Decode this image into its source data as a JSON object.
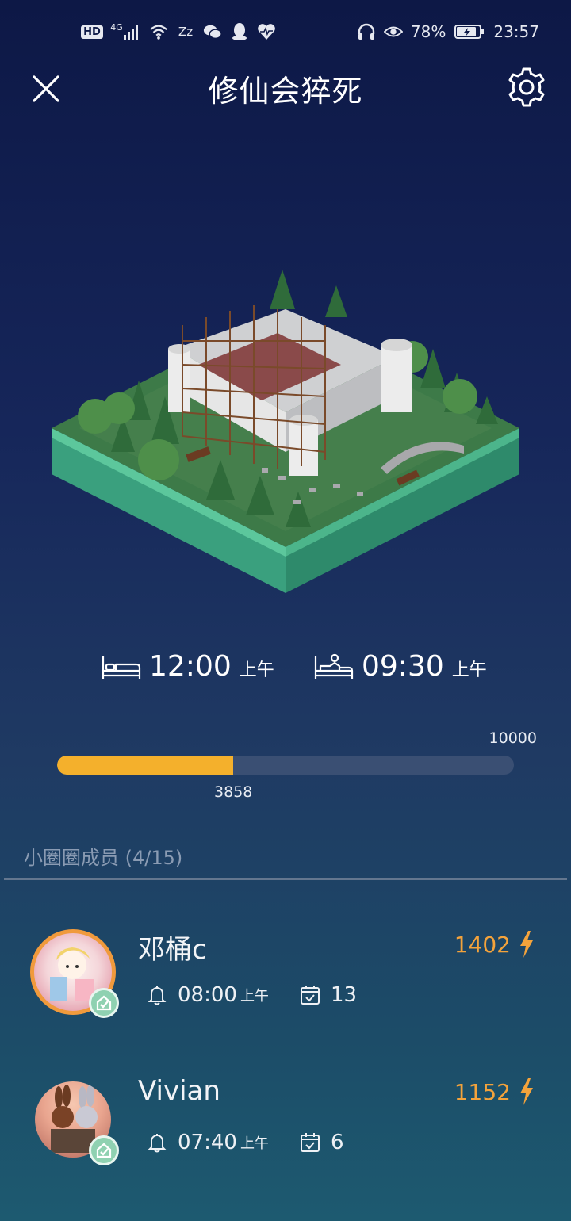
{
  "status_bar": {
    "left_icons": [
      "hd-icon",
      "signal-4g-icon",
      "wifi-icon",
      "sleep-zz-icon",
      "wechat-icon",
      "qq-icon",
      "heart-rate-icon"
    ],
    "hd_label": "HD",
    "net_label": "4G",
    "zz_label": "Zz",
    "battery_percent": "78%",
    "time": "23:57"
  },
  "header": {
    "title": "修仙会猝死",
    "close_icon": "close-icon",
    "settings_icon": "gear-icon"
  },
  "sleep_times": {
    "bedtime": {
      "icon": "bed-icon",
      "value": "12:00",
      "suffix": "上午"
    },
    "wakeup": {
      "icon": "wake-up-bed-icon",
      "value": "09:30",
      "suffix": "上午"
    }
  },
  "progress": {
    "current": "3858",
    "max": "10000",
    "fraction": 0.3858,
    "fill_color": "#f4b02c",
    "track_color": "#3a4f73"
  },
  "members_section": {
    "label": "小圈圈成员 (4/15)"
  },
  "members": [
    {
      "name": "邓桶c",
      "score": "1402",
      "alarm_time": "08:00",
      "alarm_suffix": "上午",
      "checkin_count": "13",
      "ring_color": "#f09a3c",
      "verified": true
    },
    {
      "name": "Vivian",
      "score": "1152",
      "alarm_time": "07:40",
      "alarm_suffix": "上午",
      "checkin_count": "6",
      "verified": true
    }
  ],
  "colors": {
    "accent_orange": "#f4a33b",
    "verify_green": "#8fd1b1"
  }
}
